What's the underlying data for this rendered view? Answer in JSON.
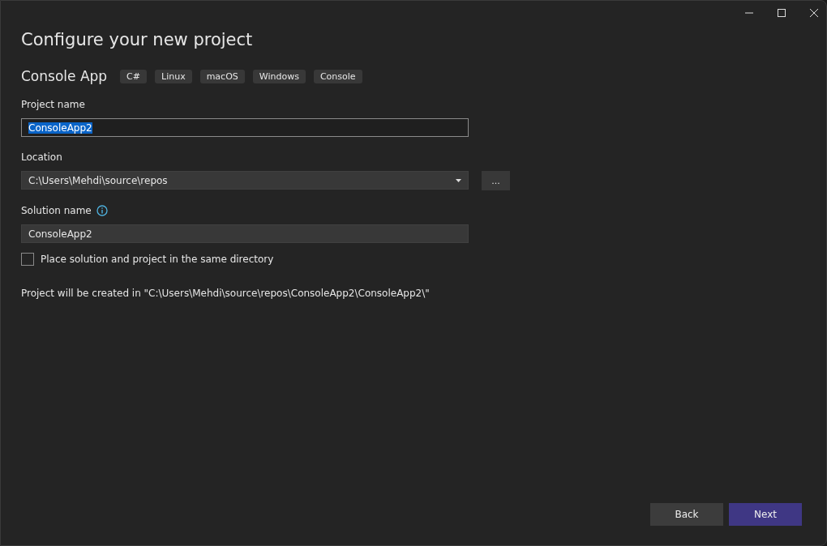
{
  "window": {
    "title": "Configure your new project"
  },
  "template": {
    "name": "Console App",
    "tags": [
      "C#",
      "Linux",
      "macOS",
      "Windows",
      "Console"
    ]
  },
  "project_name": {
    "label": "Project name",
    "value": "ConsoleApp2",
    "text_selected": true
  },
  "location": {
    "label": "Location",
    "value": "C:\\Users\\Mehdi\\source\\repos",
    "browse_label": "..."
  },
  "solution_name": {
    "label": "Solution name",
    "value": "ConsoleApp2"
  },
  "same_directory": {
    "label": "Place solution and project in the same directory",
    "checked": false
  },
  "summary": "Project will be created in \"C:\\Users\\Mehdi\\source\\repos\\ConsoleApp2\\ConsoleApp2\\\"",
  "buttons": [
    {
      "label": "Back",
      "kind": "secondary"
    },
    {
      "label": "Next",
      "kind": "primary"
    }
  ]
}
